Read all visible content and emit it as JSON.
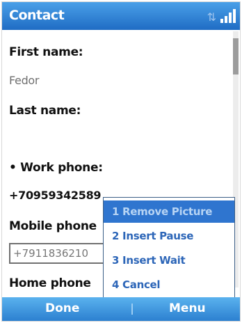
{
  "app": {
    "title": "Contact"
  },
  "status": {
    "connection_icon": "data-connection-icon",
    "signal_icon": "signal-strength-icon"
  },
  "fields": {
    "first_name_label": "First name:",
    "first_name_value": "Fedor",
    "last_name_label": "Last name:",
    "work_phone_label": "• Work phone:",
    "work_phone_value": "+70959342589",
    "mobile_phone_label": "Mobile phone",
    "mobile_phone_value": "+7911836210",
    "home_phone_label": "Home phone"
  },
  "context_menu": {
    "items": [
      {
        "label": "1 Remove Picture",
        "selected": true
      },
      {
        "label": "2 Insert Pause",
        "selected": false
      },
      {
        "label": "3 Insert Wait",
        "selected": false
      },
      {
        "label": "4 Cancel",
        "selected": false
      }
    ]
  },
  "softkeys": {
    "left": "Done",
    "right": "Menu"
  },
  "colors": {
    "title_bar": "#1f6cc4",
    "menu_highlight": "#2f75cf",
    "menu_text": "#2d66b8"
  }
}
